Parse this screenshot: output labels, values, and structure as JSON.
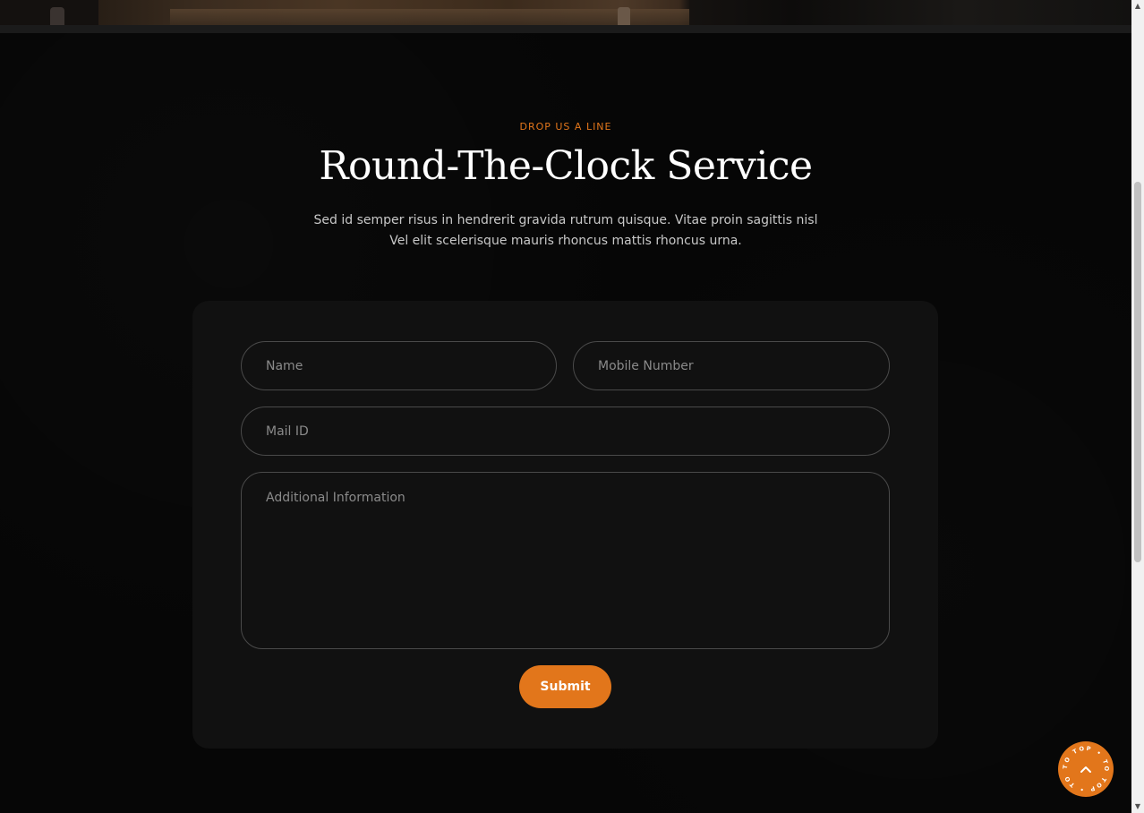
{
  "section": {
    "eyebrow": "DROP US A LINE",
    "title": "Round-The-Clock Service",
    "subtitle_line1": "Sed id semper risus in hendrerit gravida rutrum quisque. Vitae proin sagittis nisl",
    "subtitle_line2": "Vel elit scelerisque mauris rhoncus mattis rhoncus urna."
  },
  "form": {
    "name_placeholder": "Name",
    "mobile_placeholder": "Mobile Number",
    "mail_placeholder": "Mail ID",
    "info_placeholder": "Additional Information",
    "submit_label": "Submit"
  },
  "back_to_top": {
    "ring_text": "TO TOP • TO TOP • TO TOP •",
    "icon": "chevron-up-icon"
  },
  "colors": {
    "accent": "#e2761b",
    "background": "#060606",
    "card": "#111111",
    "field_border": "#4a4a4a"
  }
}
